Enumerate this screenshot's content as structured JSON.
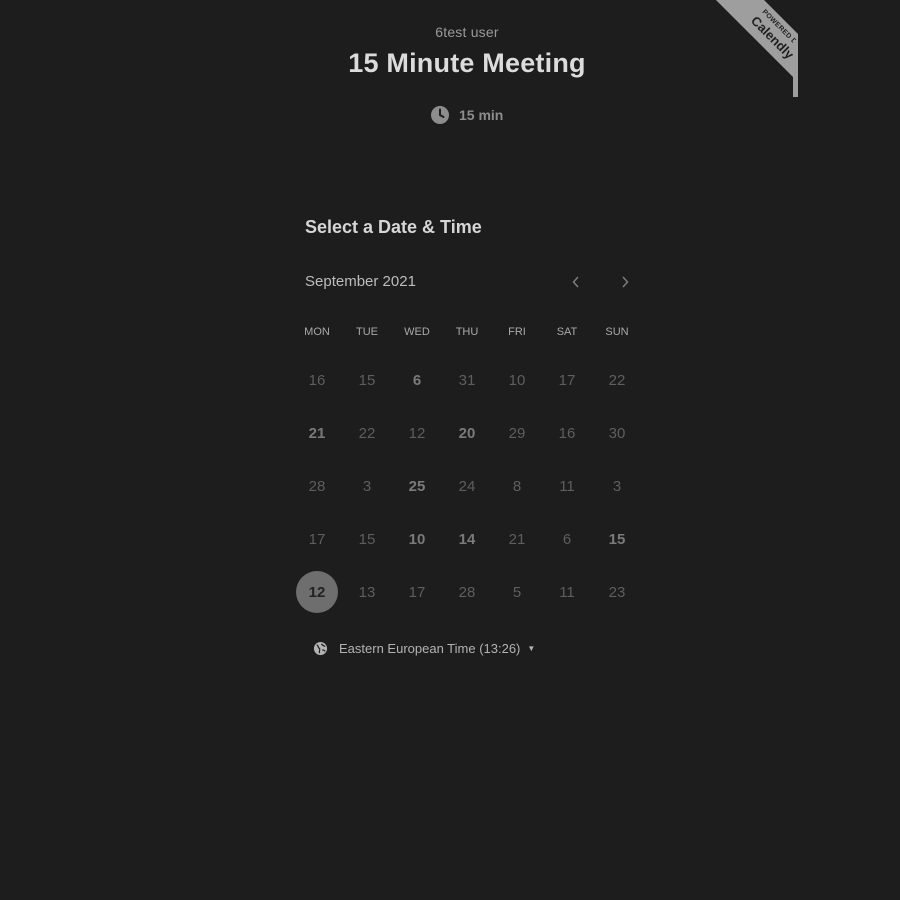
{
  "header": {
    "host_name": "6test user",
    "event_title": "15 Minute Meeting",
    "duration": "15 min"
  },
  "badge": {
    "small_text": "POWERED BY",
    "brand": "Calendly"
  },
  "calendar": {
    "section_title": "Select a Date & Time",
    "month": "September 2021",
    "prev_icon": "chevron-left-icon",
    "next_icon": "chevron-right-icon",
    "weekdays": [
      "MON",
      "TUE",
      "WED",
      "THU",
      "FRI",
      "SAT",
      "SUN"
    ],
    "weeks": [
      [
        "16",
        "15",
        "6",
        "31",
        "10",
        "17",
        "22"
      ],
      [
        "21",
        "22",
        "12",
        "20",
        "29",
        "16",
        "30"
      ],
      [
        "28",
        "3",
        "25",
        "24",
        "8",
        "11",
        "3"
      ],
      [
        "17",
        "15",
        "10",
        "14",
        "21",
        "6",
        "15"
      ],
      [
        "12",
        "13",
        "17",
        "28",
        "5",
        "11",
        "23"
      ]
    ],
    "available": [
      [
        0,
        2
      ],
      [
        1,
        0
      ],
      [
        1,
        3
      ],
      [
        2,
        2
      ],
      [
        3,
        2
      ],
      [
        3,
        3
      ],
      [
        3,
        6
      ]
    ],
    "selected": [
      4,
      0
    ]
  },
  "timezone": {
    "label": "Eastern European Time (13:26)",
    "icon": "globe-icon"
  },
  "colors": {
    "background": "#1d1d1d",
    "selected_circle": "#6e6e6e",
    "badge": "#9e9e9e"
  }
}
